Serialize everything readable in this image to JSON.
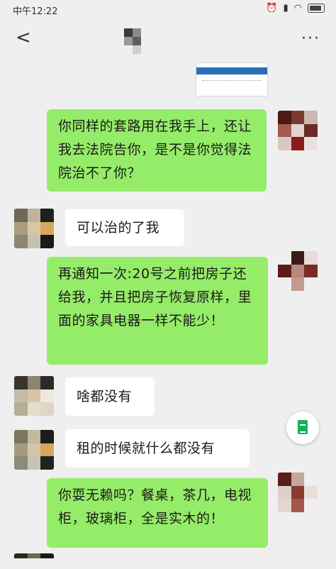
{
  "status_bar": {
    "time": "中午12:22"
  },
  "messages": [
    {
      "side": "me",
      "text": "你同样的套路用在我手上，还让我去法院告你，是不是你觉得法院治不了你？"
    },
    {
      "side": "them",
      "text": "可以治的了我"
    },
    {
      "side": "me",
      "text": "再通知一次:20号之前把房子还给我，并且把房子恢复原样，里面的家具电器一样不能少！"
    },
    {
      "side": "them",
      "text": "啥都没有"
    },
    {
      "side": "them",
      "text": "租的时候就什么都没有"
    },
    {
      "side": "me",
      "text": "你耍无赖吗？餐桌，茶几，电视柜，玻璃柜，全是实木的！"
    }
  ],
  "icons": {
    "back": "chevron-left-icon",
    "more": "more-dots-icon",
    "fab": "document-icon"
  },
  "colors": {
    "background": "#efefef",
    "my_bubble": "#95ec69",
    "their_bubble": "#ffffff"
  }
}
